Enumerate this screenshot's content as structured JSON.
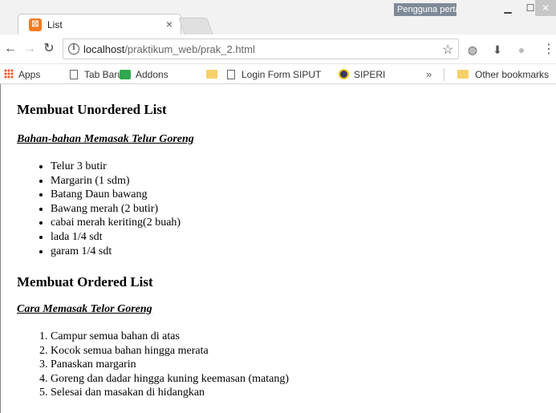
{
  "browser": {
    "tab": {
      "title": "List",
      "favicon": "xampp-icon"
    },
    "profile_label": "Pengguna perta...",
    "address": {
      "host": "localhost",
      "path": "/praktikum_web/prak_2.html"
    },
    "bookmarks": [
      {
        "label": "Apps",
        "icon": "apps-icon"
      },
      {
        "label": "Tab Baru",
        "icon": "page-icon"
      },
      {
        "label": "Addons",
        "icon": "puzzle-icon"
      },
      {
        "label": "",
        "icon": "folder-icon"
      },
      {
        "label": "Login Form SIPUT",
        "icon": "page-icon"
      },
      {
        "label": "SIPERI",
        "icon": "siperi-icon"
      }
    ],
    "bookmarks_more": "»",
    "other_bookmarks": "Other bookmarks"
  },
  "page": {
    "unordered": {
      "heading": "Membuat Unordered List",
      "subheading": "Bahan-bahan Memasak Telur Goreng",
      "items": [
        "Telur 3 butir",
        "Margarin (1 sdm)",
        "Batang Daun bawang",
        "Bawang merah (2 butir)",
        "cabai merah keriting(2 buah)",
        "lada 1/4 sdt",
        "garam 1/4 sdt"
      ]
    },
    "ordered": {
      "heading": "Membuat Ordered List",
      "subheading": "Cara Memasak Telor Goreng",
      "items": [
        "Campur semua bahan di atas",
        "Kocok semua bahan hingga merata",
        "Panaskan margarin",
        "Goreng dan dadar hingga kuning keemasan (matang)",
        "Selesai dan masakan di hidangkan"
      ]
    }
  }
}
